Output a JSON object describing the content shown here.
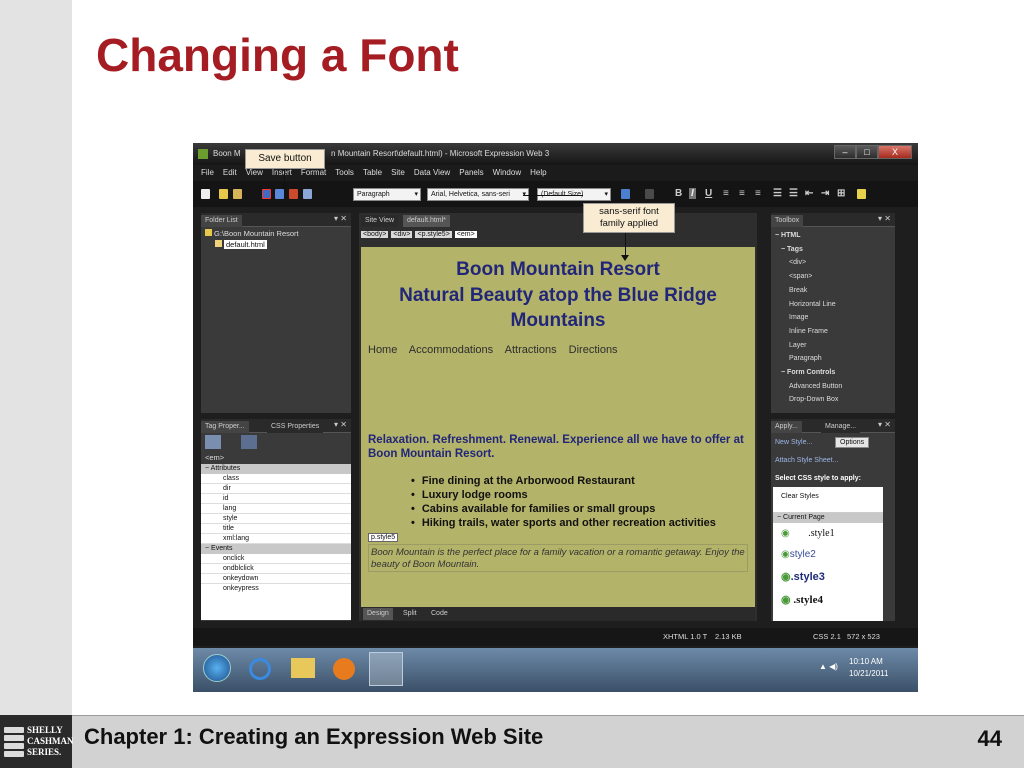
{
  "slide": {
    "title": "Changing a Font",
    "footer_title": "Chapter 1: Creating an Expression Web Site",
    "page_number": "44",
    "logo_lines": [
      "SHELLY",
      "CASHMAN",
      "SERIES."
    ]
  },
  "window": {
    "title_left": "Boon M",
    "title_right": "n Mountain Resort\\default.html) - Microsoft Expression Web 3",
    "controls": [
      "–",
      "□",
      "X"
    ]
  },
  "menu": [
    "File",
    "Edit",
    "View",
    "Insert",
    "Format",
    "Tools",
    "Table",
    "Site",
    "Data View",
    "Panels",
    "Window",
    "Help"
  ],
  "toolbar": {
    "paragraph_style": "Paragraph",
    "font_family": "Arial, Helvetica, sans-seri",
    "font_size": "(Default Size)"
  },
  "callouts": {
    "save_button": "Save button",
    "font_applied_line1": "sans-serif font",
    "font_applied_line2": "family applied"
  },
  "folder_list": {
    "title": "Folder List",
    "root": "G:\\Boon Mountain Resort",
    "file": "default.html"
  },
  "tag_properties": {
    "tab1": "Tag Proper...",
    "tab2": "CSS Properties",
    "element": "<em>",
    "attributes_header": "Attributes",
    "attributes": [
      "class",
      "dir",
      "id",
      "lang",
      "style",
      "title",
      "xml:lang"
    ],
    "events_header": "Events",
    "events": [
      "onclick",
      "ondblclick",
      "onkeydown",
      "onkeypress"
    ]
  },
  "editor": {
    "tab_site_view": "Site View",
    "tab_file": "default.html*",
    "breadcrumbs": [
      "<body>",
      "<div>",
      "<p.style5>",
      "<em>"
    ],
    "heading_lines": [
      "Boon Mountain Resort",
      "Natural Beauty atop the Blue Ridge",
      "Mountains"
    ],
    "nav_links": [
      "Home",
      "Accommodations",
      "Attractions",
      "Directions"
    ],
    "tagline": "Relaxation. Refreshment. Renewal. Experience all we have to offer at Boon Mountain Resort.",
    "bullets": [
      "Fine dining at the Arborwood Restaurant",
      "Luxury lodge rooms",
      "Cabins available for families or small groups",
      "Hiking trails, water sports and other recreation activities"
    ],
    "style_tag": "p.style5",
    "italic_text": "Boon Mountain is the perfect place for a family vacation or a romantic getaway. Enjoy the beauty of Boon Mountain.",
    "view_tabs": [
      "Design",
      "Split",
      "Code"
    ]
  },
  "toolbox": {
    "title": "Toolbox",
    "html_header": "HTML",
    "tags_header": "Tags",
    "tags": [
      "<div>",
      "<span>",
      "Break",
      "Horizontal Line",
      "Image",
      "Inline Frame",
      "Layer",
      "Paragraph"
    ],
    "form_header": "Form Controls",
    "forms": [
      "Advanced Button",
      "Drop-Down Box"
    ]
  },
  "apply_styles": {
    "tab1": "Apply...",
    "tab2": "Manage...",
    "new_style": "New Style...",
    "options": "Options",
    "attach": "Attach Style Sheet...",
    "select_label": "Select CSS style to apply:",
    "clear": "Clear Styles",
    "current_page": "Current Page",
    "styles": [
      ".style1",
      "style2",
      ".style3",
      ".style4"
    ]
  },
  "status_bar": {
    "doctype": "XHTML 1.0 T",
    "size": "2.13 KB",
    "css": "CSS 2.1",
    "dimensions": "572 x 523"
  },
  "taskbar": {
    "time": "10:10 AM",
    "date": "10/21/2011"
  }
}
